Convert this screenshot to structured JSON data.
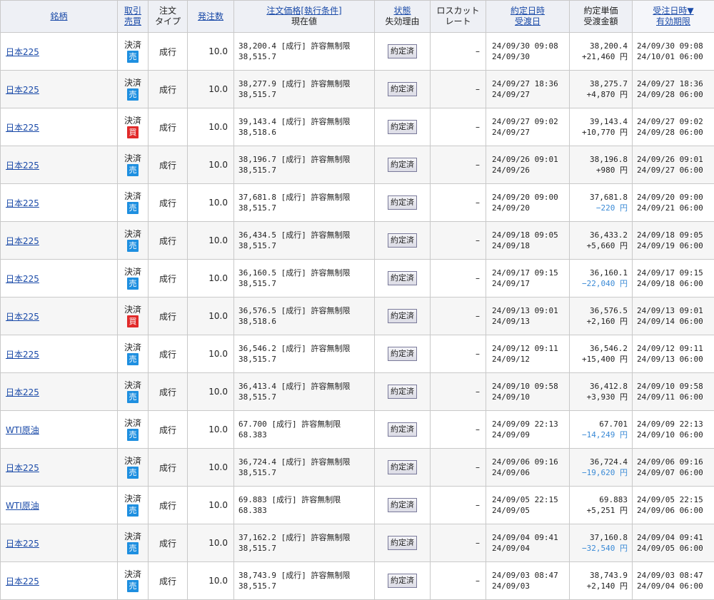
{
  "header": {
    "meigara": "銘柄",
    "torihiki_line1": "取引",
    "torihiki_line2": "売買",
    "chumon_line1": "注文",
    "chumon_line2": "タイプ",
    "hatchu": "発注数",
    "price_line1": "注文価格[執行条件]",
    "price_line2": "現在値",
    "status_line1": "状態",
    "status_line2": "失効理由",
    "losscut_line1": "ロスカット",
    "losscut_line2": "レート",
    "yakujo_line1": "約定日時",
    "yakujo_line2": "受渡日",
    "unit_line1": "約定単価",
    "unit_line2": "受渡金額",
    "juchu_line1": "受注日時▼",
    "juchu_line2": "有効期限"
  },
  "rows": [
    {
      "name": "日本225",
      "side_label": "決済",
      "side": "売",
      "side_kind": "sell",
      "type": "成行",
      "qty": "10.0",
      "price": "38,200.4 [成行] 許容無制限",
      "current": "38,515.7",
      "status": "約定済",
      "losscut": "–",
      "exec_dt": "24/09/30 09:08",
      "settle": "24/09/30",
      "unit": "38,200.4",
      "amount": "+21,460 円",
      "amount_neg": false,
      "order_dt": "24/09/30 09:08",
      "expiry": "24/10/01 06:00"
    },
    {
      "name": "日本225",
      "side_label": "決済",
      "side": "売",
      "side_kind": "sell",
      "type": "成行",
      "qty": "10.0",
      "price": "38,277.9 [成行] 許容無制限",
      "current": "38,515.7",
      "status": "約定済",
      "losscut": "–",
      "exec_dt": "24/09/27 18:36",
      "settle": "24/09/27",
      "unit": "38,275.7",
      "amount": "+4,870 円",
      "amount_neg": false,
      "order_dt": "24/09/27 18:36",
      "expiry": "24/09/28 06:00"
    },
    {
      "name": "日本225",
      "side_label": "決済",
      "side": "買",
      "side_kind": "buy",
      "type": "成行",
      "qty": "10.0",
      "price": "39,143.4 [成行] 許容無制限",
      "current": "38,518.6",
      "status": "約定済",
      "losscut": "–",
      "exec_dt": "24/09/27 09:02",
      "settle": "24/09/27",
      "unit": "39,143.4",
      "amount": "+10,770 円",
      "amount_neg": false,
      "order_dt": "24/09/27 09:02",
      "expiry": "24/09/28 06:00"
    },
    {
      "name": "日本225",
      "side_label": "決済",
      "side": "売",
      "side_kind": "sell",
      "type": "成行",
      "qty": "10.0",
      "price": "38,196.7 [成行] 許容無制限",
      "current": "38,515.7",
      "status": "約定済",
      "losscut": "–",
      "exec_dt": "24/09/26 09:01",
      "settle": "24/09/26",
      "unit": "38,196.8",
      "amount": "+980 円",
      "amount_neg": false,
      "order_dt": "24/09/26 09:01",
      "expiry": "24/09/27 06:00"
    },
    {
      "name": "日本225",
      "side_label": "決済",
      "side": "売",
      "side_kind": "sell",
      "type": "成行",
      "qty": "10.0",
      "price": "37,681.8 [成行] 許容無制限",
      "current": "38,515.7",
      "status": "約定済",
      "losscut": "–",
      "exec_dt": "24/09/20 09:00",
      "settle": "24/09/20",
      "unit": "37,681.8",
      "amount": "−220 円",
      "amount_neg": true,
      "order_dt": "24/09/20 09:00",
      "expiry": "24/09/21 06:00"
    },
    {
      "name": "日本225",
      "side_label": "決済",
      "side": "売",
      "side_kind": "sell",
      "type": "成行",
      "qty": "10.0",
      "price": "36,434.5 [成行] 許容無制限",
      "current": "38,515.7",
      "status": "約定済",
      "losscut": "–",
      "exec_dt": "24/09/18 09:05",
      "settle": "24/09/18",
      "unit": "36,433.2",
      "amount": "+5,660 円",
      "amount_neg": false,
      "order_dt": "24/09/18 09:05",
      "expiry": "24/09/19 06:00"
    },
    {
      "name": "日本225",
      "side_label": "決済",
      "side": "売",
      "side_kind": "sell",
      "type": "成行",
      "qty": "10.0",
      "price": "36,160.5 [成行] 許容無制限",
      "current": "38,515.7",
      "status": "約定済",
      "losscut": "–",
      "exec_dt": "24/09/17 09:15",
      "settle": "24/09/17",
      "unit": "36,160.1",
      "amount": "−22,040 円",
      "amount_neg": true,
      "order_dt": "24/09/17 09:15",
      "expiry": "24/09/18 06:00"
    },
    {
      "name": "日本225",
      "side_label": "決済",
      "side": "買",
      "side_kind": "buy",
      "type": "成行",
      "qty": "10.0",
      "price": "36,576.5 [成行] 許容無制限",
      "current": "38,518.6",
      "status": "約定済",
      "losscut": "–",
      "exec_dt": "24/09/13 09:01",
      "settle": "24/09/13",
      "unit": "36,576.5",
      "amount": "+2,160 円",
      "amount_neg": false,
      "order_dt": "24/09/13 09:01",
      "expiry": "24/09/14 06:00"
    },
    {
      "name": "日本225",
      "side_label": "決済",
      "side": "売",
      "side_kind": "sell",
      "type": "成行",
      "qty": "10.0",
      "price": "36,546.2 [成行] 許容無制限",
      "current": "38,515.7",
      "status": "約定済",
      "losscut": "–",
      "exec_dt": "24/09/12 09:11",
      "settle": "24/09/12",
      "unit": "36,546.2",
      "amount": "+15,400 円",
      "amount_neg": false,
      "order_dt": "24/09/12 09:11",
      "expiry": "24/09/13 06:00"
    },
    {
      "name": "日本225",
      "side_label": "決済",
      "side": "売",
      "side_kind": "sell",
      "type": "成行",
      "qty": "10.0",
      "price": "36,413.4 [成行] 許容無制限",
      "current": "38,515.7",
      "status": "約定済",
      "losscut": "–",
      "exec_dt": "24/09/10 09:58",
      "settle": "24/09/10",
      "unit": "36,412.8",
      "amount": "+3,930 円",
      "amount_neg": false,
      "order_dt": "24/09/10 09:58",
      "expiry": "24/09/11 06:00"
    },
    {
      "name": "WTI原油",
      "side_label": "決済",
      "side": "売",
      "side_kind": "sell",
      "type": "成行",
      "qty": "10.0",
      "price": "67.700 [成行] 許容無制限",
      "current": "68.383",
      "status": "約定済",
      "losscut": "–",
      "exec_dt": "24/09/09 22:13",
      "settle": "24/09/09",
      "unit": "67.701",
      "amount": "−14,249 円",
      "amount_neg": true,
      "order_dt": "24/09/09 22:13",
      "expiry": "24/09/10 06:00"
    },
    {
      "name": "日本225",
      "side_label": "決済",
      "side": "売",
      "side_kind": "sell",
      "type": "成行",
      "qty": "10.0",
      "price": "36,724.4 [成行] 許容無制限",
      "current": "38,515.7",
      "status": "約定済",
      "losscut": "–",
      "exec_dt": "24/09/06 09:16",
      "settle": "24/09/06",
      "unit": "36,724.4",
      "amount": "−19,620 円",
      "amount_neg": true,
      "order_dt": "24/09/06 09:16",
      "expiry": "24/09/07 06:00"
    },
    {
      "name": "WTI原油",
      "side_label": "決済",
      "side": "売",
      "side_kind": "sell",
      "type": "成行",
      "qty": "10.0",
      "price": "69.883 [成行] 許容無制限",
      "current": "68.383",
      "status": "約定済",
      "losscut": "–",
      "exec_dt": "24/09/05 22:15",
      "settle": "24/09/05",
      "unit": "69.883",
      "amount": "+5,251 円",
      "amount_neg": false,
      "order_dt": "24/09/05 22:15",
      "expiry": "24/09/06 06:00"
    },
    {
      "name": "日本225",
      "side_label": "決済",
      "side": "売",
      "side_kind": "sell",
      "type": "成行",
      "qty": "10.0",
      "price": "37,162.2 [成行] 許容無制限",
      "current": "38,515.7",
      "status": "約定済",
      "losscut": "–",
      "exec_dt": "24/09/04 09:41",
      "settle": "24/09/04",
      "unit": "37,160.8",
      "amount": "−32,540 円",
      "amount_neg": true,
      "order_dt": "24/09/04 09:41",
      "expiry": "24/09/05 06:00"
    },
    {
      "name": "日本225",
      "side_label": "決済",
      "side": "売",
      "side_kind": "sell",
      "type": "成行",
      "qty": "10.0",
      "price": "38,743.9 [成行] 許容無制限",
      "current": "38,515.7",
      "status": "約定済",
      "losscut": "–",
      "exec_dt": "24/09/03 08:47",
      "settle": "24/09/03",
      "unit": "38,743.9",
      "amount": "+2,140 円",
      "amount_neg": false,
      "order_dt": "24/09/03 08:47",
      "expiry": "24/09/04 06:00"
    }
  ]
}
